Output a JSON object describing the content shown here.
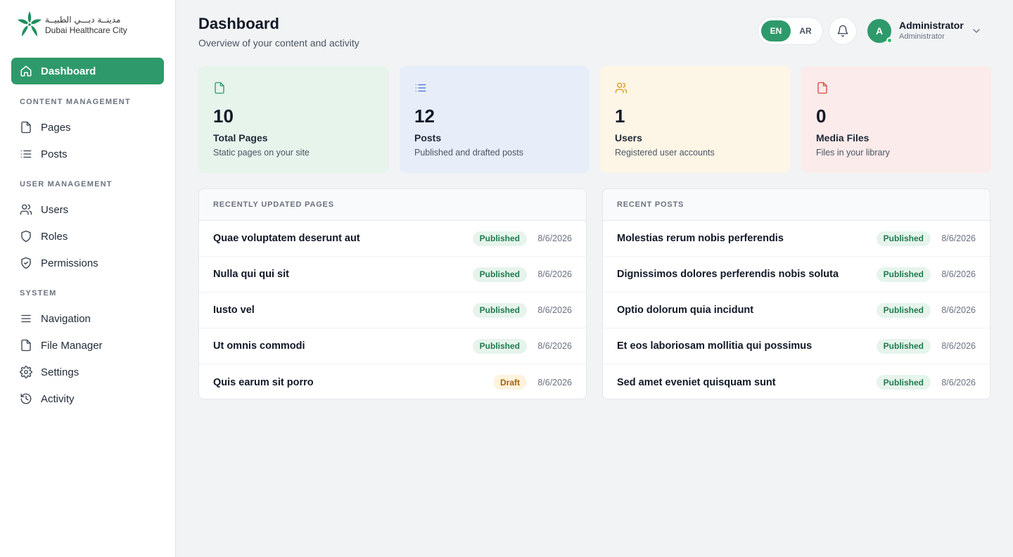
{
  "logo": {
    "arabic": "مدينــة دبـــي الطبيــة",
    "english": "Dubai Healthcare City"
  },
  "sidebar": {
    "dashboard": "Dashboard",
    "sections": {
      "content": "CONTENT MANAGEMENT",
      "user": "USER MANAGEMENT",
      "system": "SYSTEM"
    },
    "items": {
      "pages": "Pages",
      "posts": "Posts",
      "users": "Users",
      "roles": "Roles",
      "permissions": "Permissions",
      "navigation": "Navigation",
      "file_manager": "File Manager",
      "settings": "Settings",
      "activity": "Activity"
    }
  },
  "header": {
    "title": "Dashboard",
    "subtitle": "Overview of your content and activity",
    "lang_en": "EN",
    "lang_ar": "AR",
    "avatar_initial": "A",
    "user_name": "Administrator",
    "user_role": "Administrator"
  },
  "stats": [
    {
      "value": "10",
      "label": "Total Pages",
      "desc": "Static pages on your site",
      "icon": "file-icon",
      "color": "#2e9a6b"
    },
    {
      "value": "12",
      "label": "Posts",
      "desc": "Published and drafted posts",
      "icon": "list-icon",
      "color": "#3b6fd4"
    },
    {
      "value": "1",
      "label": "Users",
      "desc": "Registered user accounts",
      "icon": "users-icon",
      "color": "#d99a1c"
    },
    {
      "value": "0",
      "label": "Media Files",
      "desc": "Files in your library",
      "icon": "file-icon",
      "color": "#d94b3b"
    }
  ],
  "recent_pages": {
    "heading": "RECENTLY UPDATED PAGES",
    "rows": [
      {
        "title": "Quae voluptatem deserunt aut",
        "status": "Published",
        "date": "8/6/2026"
      },
      {
        "title": "Nulla qui qui sit",
        "status": "Published",
        "date": "8/6/2026"
      },
      {
        "title": "Iusto vel",
        "status": "Published",
        "date": "8/6/2026"
      },
      {
        "title": "Ut omnis commodi",
        "status": "Published",
        "date": "8/6/2026"
      },
      {
        "title": "Quis earum sit porro",
        "status": "Draft",
        "date": "8/6/2026"
      }
    ]
  },
  "recent_posts": {
    "heading": "RECENT POSTS",
    "rows": [
      {
        "title": "Molestias rerum nobis perferendis",
        "status": "Published",
        "date": "8/6/2026"
      },
      {
        "title": "Dignissimos dolores perferendis nobis soluta",
        "status": "Published",
        "date": "8/6/2026"
      },
      {
        "title": "Optio dolorum quia incidunt",
        "status": "Published",
        "date": "8/6/2026"
      },
      {
        "title": "Et eos laboriosam mollitia qui possimus",
        "status": "Published",
        "date": "8/6/2026"
      },
      {
        "title": "Sed amet eveniet quisquam sunt",
        "status": "Published",
        "date": "8/6/2026"
      }
    ]
  }
}
